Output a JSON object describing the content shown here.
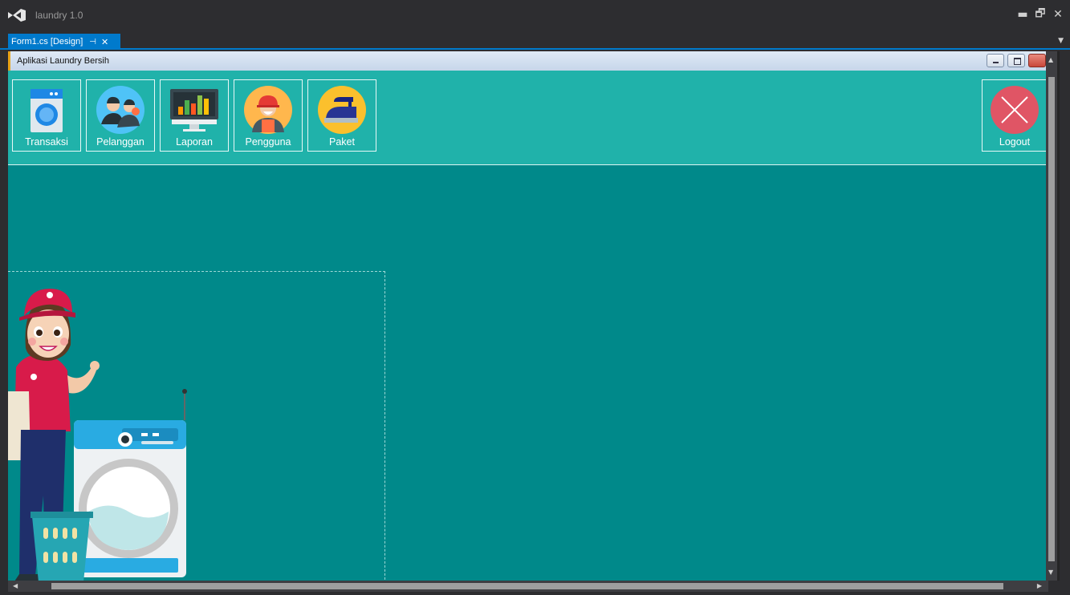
{
  "titlebar": {
    "app_title": "laundry 1.0",
    "minimize_glyph": "▬",
    "restore_glyph": "🗗",
    "close_glyph": "✕"
  },
  "tabs": {
    "active_label": "Form1.cs [Design]",
    "pin_glyph": "⊣",
    "close_glyph": "✕",
    "dropdown_glyph": "▼"
  },
  "form": {
    "caption": "Aplikasi Laundry Bersih",
    "colors": {
      "menu_panel": "#20b2aa",
      "body": "#00898a"
    }
  },
  "nav": {
    "items": [
      {
        "label": "Transaksi",
        "icon": "washing-machine-icon"
      },
      {
        "label": "Pelanggan",
        "icon": "customers-icon"
      },
      {
        "label": "Laporan",
        "icon": "report-chart-icon"
      },
      {
        "label": "Pengguna",
        "icon": "worker-icon"
      },
      {
        "label": "Paket",
        "icon": "iron-icon"
      }
    ],
    "logout": {
      "label": "Logout",
      "icon": "logout-x-icon"
    }
  },
  "scroll": {
    "up": "▲",
    "down": "▼",
    "left": "◀",
    "right": "▶"
  }
}
